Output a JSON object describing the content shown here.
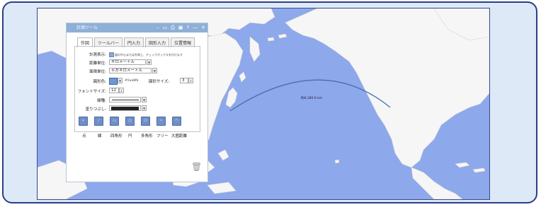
{
  "colors": {
    "border": "#2b3f86",
    "ocean": "#8ea8ec",
    "land": "#f6f6f6",
    "arc": "#4a6fa5",
    "title_bar": "#8fb0d6"
  },
  "map": {
    "arc_label": "約8,180.6 km"
  },
  "panel": {
    "title": "計測ツール",
    "titlebar_icons": [
      {
        "icon": "minimize-icon",
        "glyph": "–"
      },
      {
        "icon": "window-icon",
        "glyph": "▭"
      },
      {
        "icon": "print-icon",
        "glyph": "⎙"
      },
      {
        "icon": "save-icon",
        "glyph": "▣"
      },
      {
        "icon": "help-icon",
        "glyph": "?"
      },
      {
        "icon": "collapse-icon",
        "glyph": "—"
      },
      {
        "icon": "close-icon",
        "glyph": "✕"
      }
    ],
    "tabs": [
      "作図",
      "ツールバー",
      "円入力",
      "図形入力",
      "位置情報"
    ],
    "form": {
      "measure_display_label": "計測表示:",
      "measure_display_hint": "図の中心または外周上、チェックボックスを付けます",
      "distance_unit_label": "距離単位:",
      "distance_unit_value": "キロメートル",
      "area_unit_label": "面積単位:",
      "area_unit_value": "平方キロメートル",
      "shape_color_label": "図形色:",
      "shape_color_value": "#5aa8fb",
      "shape_size_label": "図形サイズ:",
      "shape_size_value": "3",
      "font_size_label": "フォントサイズ:",
      "font_size_value": "12",
      "line_style_label": "線種:",
      "fill_label": "塗りつぶし:"
    },
    "tools": [
      {
        "label": "点",
        "icon": "point-icon"
      },
      {
        "label": "線",
        "icon": "line-icon"
      },
      {
        "label": "四角形",
        "icon": "rectangle-icon"
      },
      {
        "label": "円",
        "icon": "circle-icon"
      },
      {
        "label": "多角形",
        "icon": "polygon-icon"
      },
      {
        "label": "フリー",
        "icon": "freehand-icon"
      },
      {
        "label": "大圏距離",
        "icon": "great-circle-icon"
      }
    ]
  }
}
